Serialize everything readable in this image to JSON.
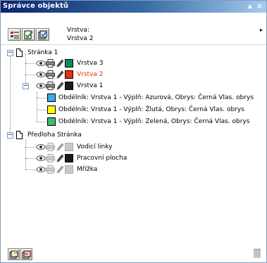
{
  "window": {
    "title": "Správce objektů",
    "collapse_glyph": "▲",
    "close_glyph": "×"
  },
  "toolbar": {
    "layer_label": "Vrstva:",
    "layer_value": "Vrstva 2",
    "menu_glyph": "▸"
  },
  "tree": {
    "page1": {
      "label": "Stránka 1",
      "expanded": true
    },
    "layers": [
      {
        "label": "Vrstva 3",
        "color": "#138a52",
        "label_color": "#000000"
      },
      {
        "label": "Vrstva 2",
        "color": "#e8320a",
        "label_color": "#e8320a"
      },
      {
        "label": "Vrstva 1",
        "color": "#1a1a1a",
        "label_color": "#000000"
      }
    ],
    "objects": [
      {
        "label": "Obdélník: Vrstva 1  - Výplň: Azurová, Obrys: Černá  Vlas. obrys",
        "color": "#3aaae8"
      },
      {
        "label": "Obdélník: Vrstva 1  - Výplň: Žlutá, Obrys: Černá  Vlas. obrys",
        "color": "#ffff00"
      },
      {
        "label": "Obdélník: Vrstva 1  - Výplň: Zelená, Obrys: Černá  Vlas. obrys",
        "color": "#3cb878"
      }
    ],
    "master_page": {
      "label": "Předloha Stránka"
    },
    "master_layers": [
      {
        "label": "Vodicí linky",
        "color": "#c8c8c8"
      },
      {
        "label": "Pracovní plocha",
        "color": "#1a1a1a"
      },
      {
        "label": "Mřížka",
        "color": "#c8c8c8"
      }
    ],
    "expanded_glyph": "−"
  },
  "colors": {
    "title_bar_start": "#0a246a",
    "title_bar_end": "#a6caf0",
    "active_layer": "#e8320a"
  }
}
